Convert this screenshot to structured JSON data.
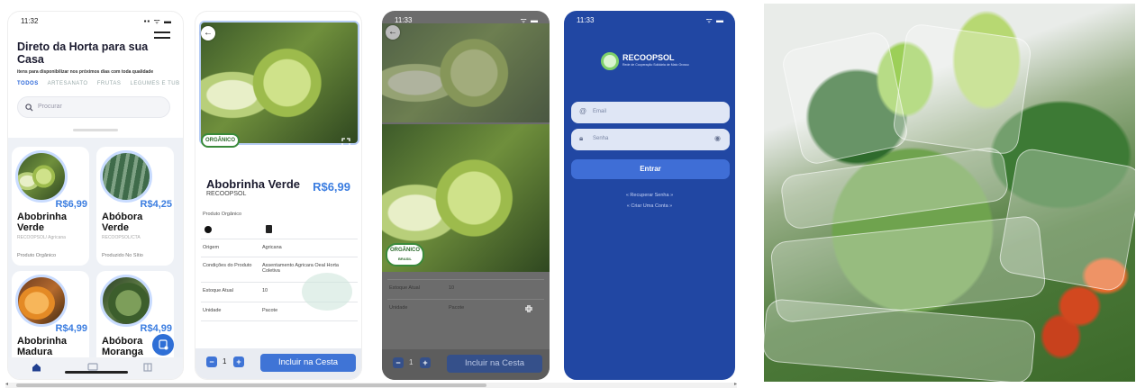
{
  "screen1": {
    "time": "11:32",
    "title": "Direto da Horta para sua Casa",
    "subtitle": "itens para disponibilizar nos próximos dias com toda qualidade",
    "tabs": [
      "TODOS",
      "ARTESANATO",
      "FRUTAS",
      "LEGUMES E TUB"
    ],
    "search_placeholder": "Procurar",
    "products": [
      {
        "price": "R$6,99",
        "name": "Abobrinha Verde",
        "coop": "RECOOPSOL/ Agricana",
        "tag": "Produto Orgânico"
      },
      {
        "price": "R$4,25",
        "name": "Abóbora Verde",
        "coop": "RECOOPSOL/CTA",
        "tag": "Produzido No Sítio"
      },
      {
        "price": "R$4,99",
        "name": "Abobrinha Madura",
        "coop": "",
        "tag": ""
      },
      {
        "price": "R$4,99",
        "name": "Abóbora Moranga",
        "coop": "",
        "tag": ""
      }
    ],
    "nav": [
      "home-icon",
      "chat-icon",
      "grid-icon"
    ]
  },
  "screen2": {
    "badge": "ORGÂNICO",
    "name": "Abobrinha Verde",
    "coop": "RECOOPSOL",
    "price": "R$6,99",
    "desc": "Produto Orgânico",
    "details": [
      {
        "k": "Origem",
        "v": "Agricana"
      },
      {
        "k": "Condições do Produto",
        "v": "Assentamento Agricara Oeal Horta Coletiva"
      },
      {
        "k": "Estoque Atual",
        "v": "10"
      },
      {
        "k": "Unidade",
        "v": "Pacote"
      }
    ],
    "qty": "1",
    "cta": "Incluir na Cesta"
  },
  "screen3": {
    "time": "11:33",
    "badge": "ORGÂNICO",
    "badge_sub": "BRASIL",
    "details": [
      {
        "k": "Estoque Atual",
        "v": "10"
      },
      {
        "k": "Unidade",
        "v": "Pacote"
      }
    ],
    "qty": "1",
    "cta": "Incluir na Cesta"
  },
  "screen4": {
    "time": "11:33",
    "brand": "RECOOPSOL",
    "brand_tag": "Rede de Cooperação Solidária de Mato Grosso",
    "email_label": "Email",
    "password_label": "Senha",
    "login": "Entrar",
    "recover": "« Recuperar Senha »",
    "create": "« Criar Uma Conta »"
  }
}
